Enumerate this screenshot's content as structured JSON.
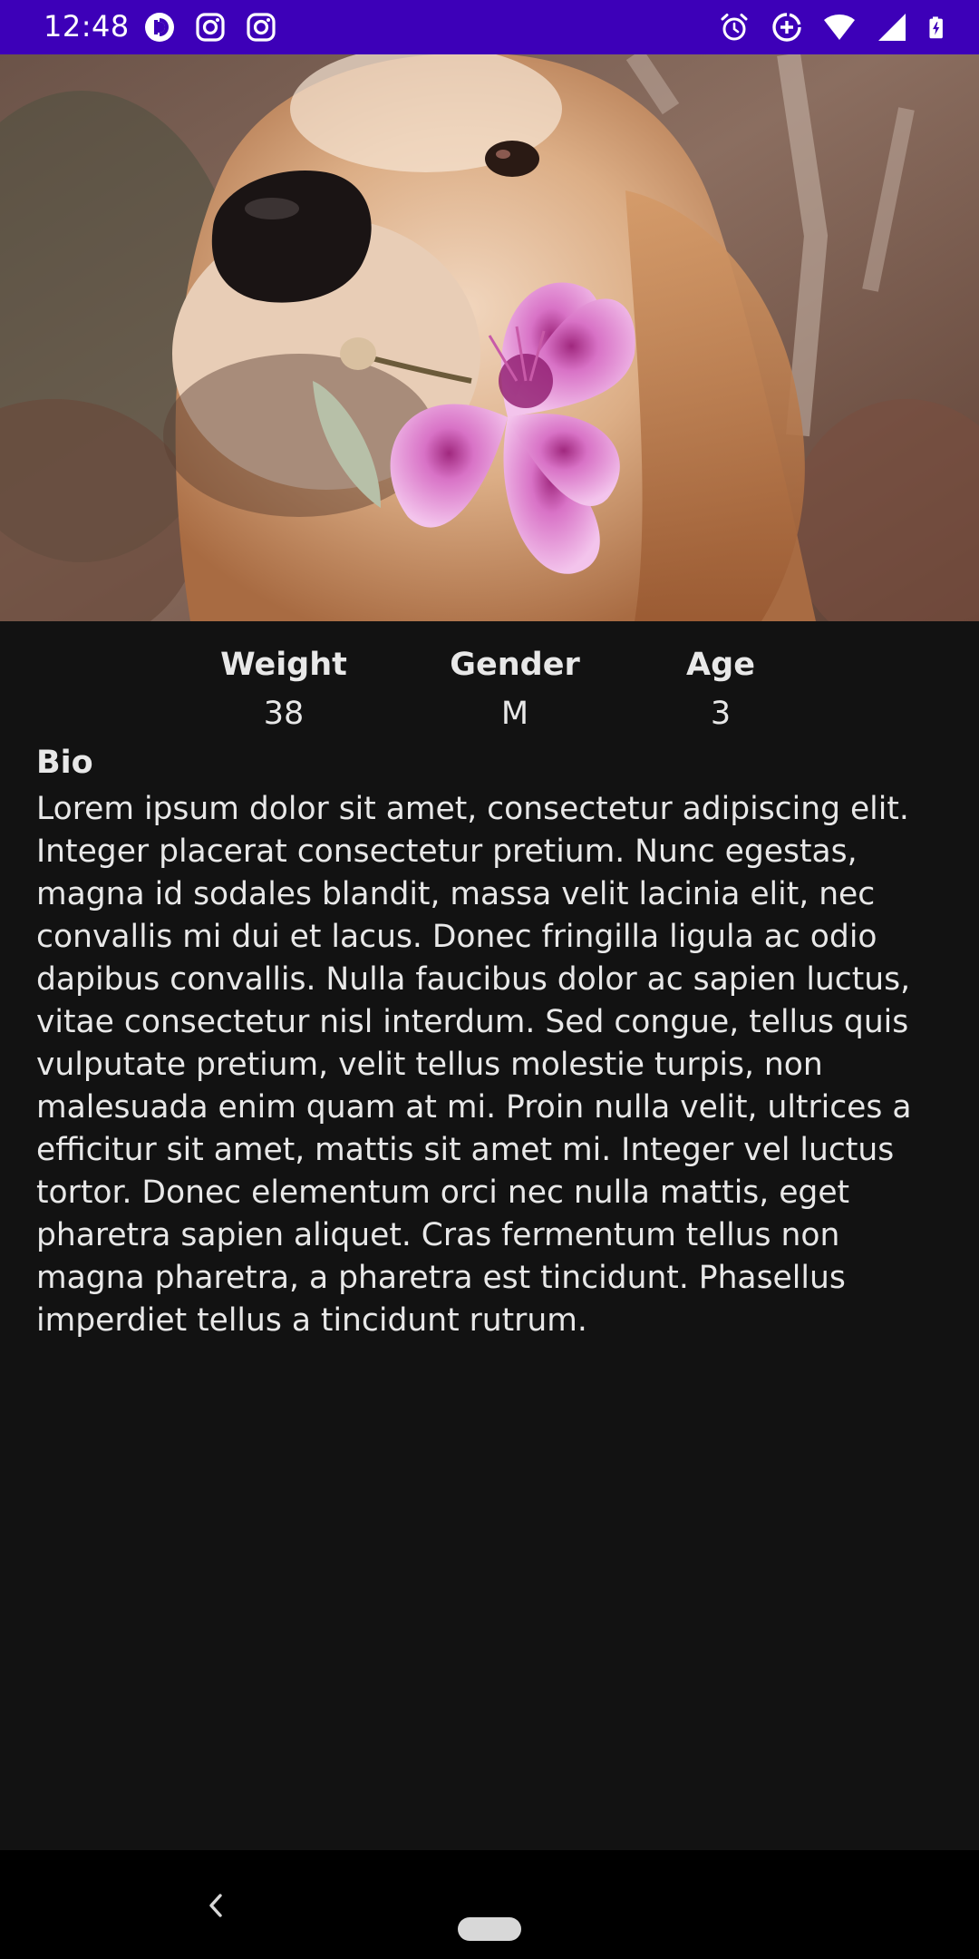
{
  "status_bar": {
    "time": "12:48",
    "background_color": "#3d00b8",
    "left_icons": [
      "pocket-casts-icon",
      "instagram-icon",
      "instagram-icon"
    ],
    "right_icons": [
      "alarm-icon",
      "data-saver-icon",
      "wifi-icon",
      "cellular-signal-icon",
      "battery-charging-icon"
    ]
  },
  "hero": {
    "image": "dog-with-pink-flower-photo"
  },
  "stats": {
    "weight": {
      "label": "Weight",
      "value": "38"
    },
    "gender": {
      "label": "Gender",
      "value": "M"
    },
    "age": {
      "label": "Age",
      "value": "3"
    }
  },
  "bio": {
    "heading": "Bio",
    "text": "Lorem ipsum dolor sit amet, consectetur adipiscing elit. Integer placerat consectetur pretium. Nunc egestas, magna id sodales blandit, massa velit lacinia elit, nec convallis mi dui et lacus. Donec fringilla ligula ac odio dapibus convallis. Nulla faucibus dolor ac sapien luctus, vitae consectetur nisl interdum. Sed congue, tellus quis vulputate pretium, velit tellus molestie turpis, non malesuada enim quam at mi. Proin nulla velit, ultrices a efficitur sit amet, mattis sit amet mi. Integer vel luctus tortor. Donec elementum orci nec nulla mattis, eget pharetra sapien aliquet. Cras fermentum tellus non magna pharetra, a pharetra est tincidunt. Phasellus imperdiet tellus a tincidunt rutrum."
  },
  "nav_bar": {
    "back_icon": "back-chevron-icon",
    "home_icon": "home-pill-icon"
  },
  "colors": {
    "background": "#121212",
    "text": "#e8e8e8",
    "nav_background": "#000000"
  }
}
